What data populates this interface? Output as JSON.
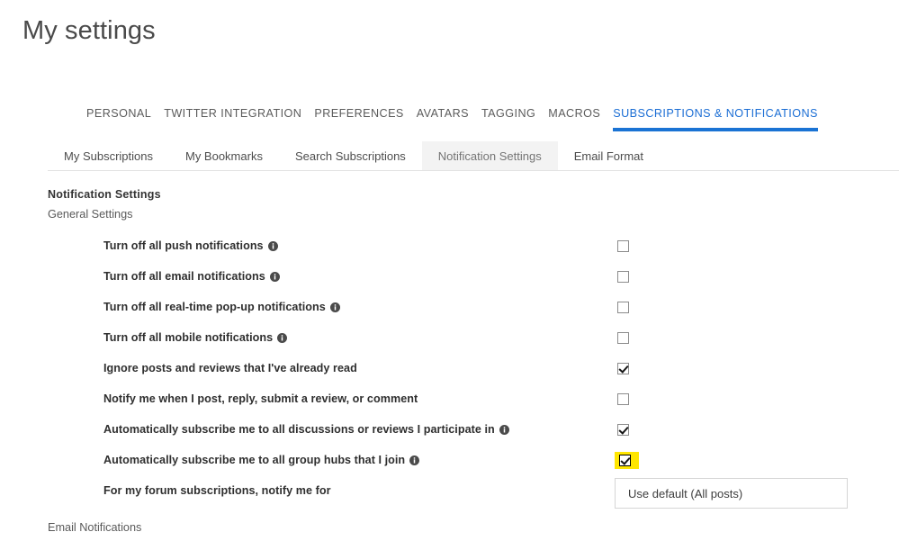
{
  "page": {
    "title": "My settings"
  },
  "primary_nav": {
    "items": [
      {
        "label": "PERSONAL",
        "active": false
      },
      {
        "label": "TWITTER INTEGRATION",
        "active": false
      },
      {
        "label": "PREFERENCES",
        "active": false
      },
      {
        "label": "AVATARS",
        "active": false
      },
      {
        "label": "TAGGING",
        "active": false
      },
      {
        "label": "MACROS",
        "active": false
      },
      {
        "label": "SUBSCRIPTIONS & NOTIFICATIONS",
        "active": true
      }
    ],
    "active_color": "#1a73d4"
  },
  "sub_nav": {
    "items": [
      {
        "label": "My Subscriptions",
        "active": false
      },
      {
        "label": "My Bookmarks",
        "active": false
      },
      {
        "label": "Search Subscriptions",
        "active": false
      },
      {
        "label": "Notification Settings",
        "active": true
      },
      {
        "label": "Email Format",
        "active": false
      }
    ],
    "active_bg": "#f3f3f3"
  },
  "content": {
    "section_title": "Notification Settings",
    "section_subtitle": "General Settings",
    "section_footer": "Email Notifications"
  },
  "settings": {
    "rows": [
      {
        "label": "Turn off all push notifications",
        "info": true,
        "control": "checkbox",
        "checked": false,
        "highlighted": false
      },
      {
        "label": "Turn off all email notifications",
        "info": true,
        "control": "checkbox",
        "checked": false,
        "highlighted": false
      },
      {
        "label": "Turn off all real-time pop-up notifications",
        "info": true,
        "control": "checkbox",
        "checked": false,
        "highlighted": false
      },
      {
        "label": "Turn off all mobile notifications",
        "info": true,
        "control": "checkbox",
        "checked": false,
        "highlighted": false
      },
      {
        "label": "Ignore posts and reviews that I've already read",
        "info": false,
        "control": "checkbox",
        "checked": true,
        "highlighted": false
      },
      {
        "label": "Notify me when I post, reply, submit a review, or comment",
        "info": false,
        "control": "checkbox",
        "checked": false,
        "highlighted": false
      },
      {
        "label": "Automatically subscribe me to all discussions or reviews I participate in",
        "info": true,
        "control": "checkbox",
        "checked": true,
        "highlighted": false
      },
      {
        "label": "Automatically subscribe me to all group hubs that I join",
        "info": true,
        "control": "checkbox",
        "checked": true,
        "highlighted": true,
        "highlight_color": "#ffe600"
      },
      {
        "label": "For my forum subscriptions, notify me for",
        "info": false,
        "control": "select",
        "value": "Use default (All posts)"
      }
    ]
  },
  "icons": {
    "info": "info-circle-icon",
    "check": "check-mark-icon"
  }
}
